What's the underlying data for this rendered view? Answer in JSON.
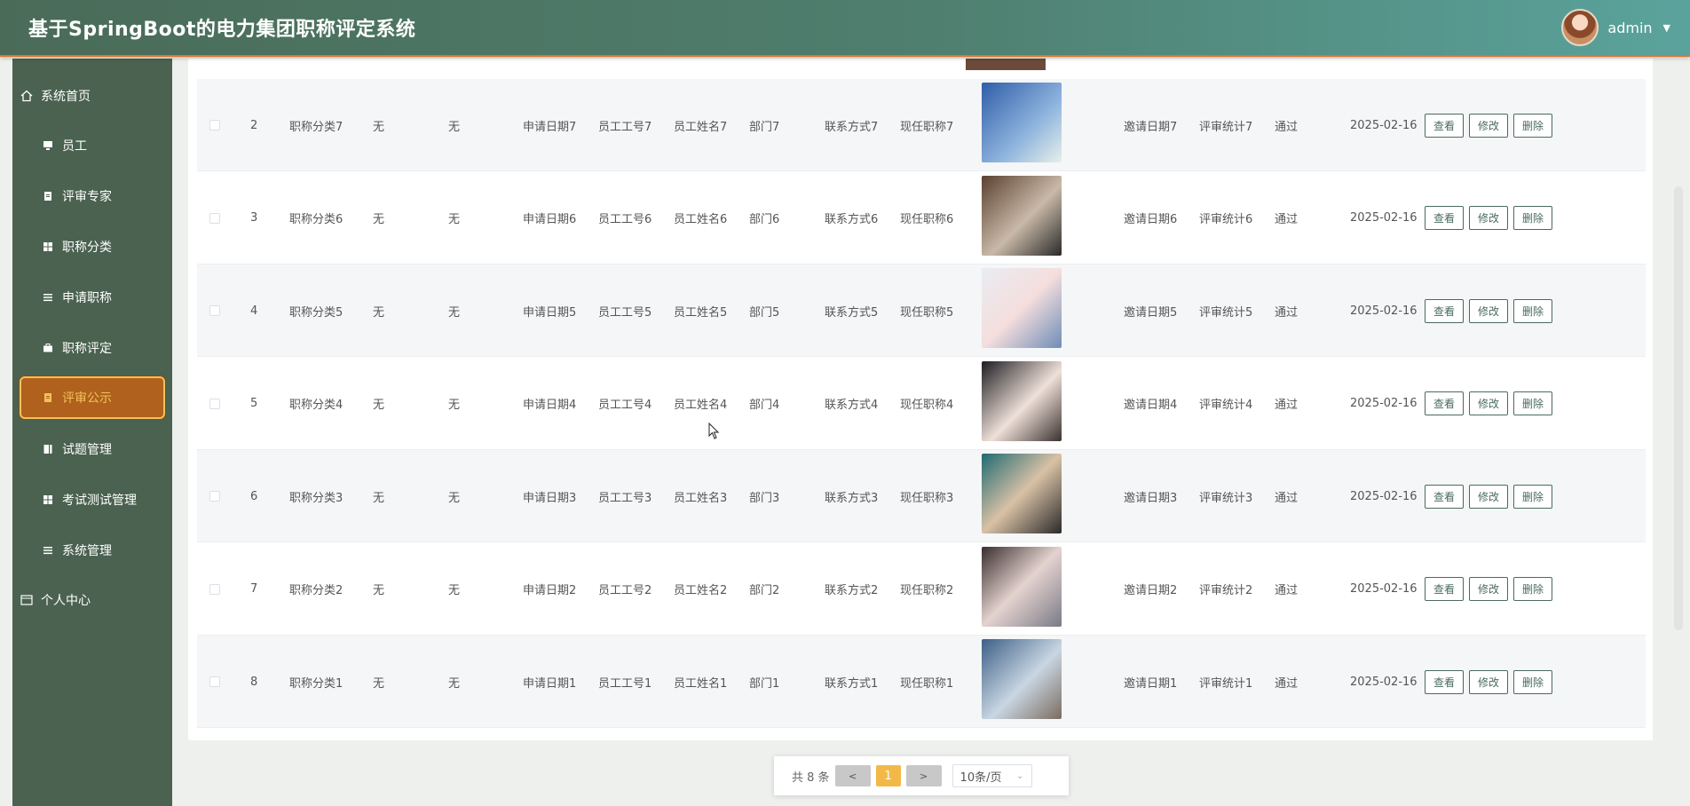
{
  "header": {
    "title": "基于SpringBoot的电力集团职称评定系统",
    "username": "admin"
  },
  "sidebar": {
    "items": [
      {
        "label": "系统首页",
        "icon": "home-icon"
      },
      {
        "label": "员工",
        "icon": "monitor-icon"
      },
      {
        "label": "评审专家",
        "icon": "clipboard-icon"
      },
      {
        "label": "职称分类",
        "icon": "grid-icon"
      },
      {
        "label": "申请职称",
        "icon": "list-icon"
      },
      {
        "label": "职称评定",
        "icon": "briefcase-icon"
      },
      {
        "label": "评审公示",
        "icon": "clipboard-icon",
        "active": true
      },
      {
        "label": "试题管理",
        "icon": "book-icon"
      },
      {
        "label": "考试测试管理",
        "icon": "grid-icon"
      },
      {
        "label": "系统管理",
        "icon": "list-icon"
      },
      {
        "label": "个人中心",
        "icon": "id-card-icon"
      }
    ]
  },
  "table": {
    "rows": [
      {
        "index": "2",
        "category": "职称分类7",
        "a": "无",
        "b": "无",
        "apply_date": "申请日期7",
        "emp_no": "员工工号7",
        "emp_name": "员工姓名7",
        "dept": "部门7",
        "contact": "联系方式7",
        "current_title": "现任职称7",
        "invite_date": "邀请日期7",
        "stats": "评审统计7",
        "status": "通过",
        "date": "2025-02-16"
      },
      {
        "index": "3",
        "category": "职称分类6",
        "a": "无",
        "b": "无",
        "apply_date": "申请日期6",
        "emp_no": "员工工号6",
        "emp_name": "员工姓名6",
        "dept": "部门6",
        "contact": "联系方式6",
        "current_title": "现任职称6",
        "invite_date": "邀请日期6",
        "stats": "评审统计6",
        "status": "通过",
        "date": "2025-02-16"
      },
      {
        "index": "4",
        "category": "职称分类5",
        "a": "无",
        "b": "无",
        "apply_date": "申请日期5",
        "emp_no": "员工工号5",
        "emp_name": "员工姓名5",
        "dept": "部门5",
        "contact": "联系方式5",
        "current_title": "现任职称5",
        "invite_date": "邀请日期5",
        "stats": "评审统计5",
        "status": "通过",
        "date": "2025-02-16"
      },
      {
        "index": "5",
        "category": "职称分类4",
        "a": "无",
        "b": "无",
        "apply_date": "申请日期4",
        "emp_no": "员工工号4",
        "emp_name": "员工姓名4",
        "dept": "部门4",
        "contact": "联系方式4",
        "current_title": "现任职称4",
        "invite_date": "邀请日期4",
        "stats": "评审统计4",
        "status": "通过",
        "date": "2025-02-16"
      },
      {
        "index": "6",
        "category": "职称分类3",
        "a": "无",
        "b": "无",
        "apply_date": "申请日期3",
        "emp_no": "员工工号3",
        "emp_name": "员工姓名3",
        "dept": "部门3",
        "contact": "联系方式3",
        "current_title": "现任职称3",
        "invite_date": "邀请日期3",
        "stats": "评审统计3",
        "status": "通过",
        "date": "2025-02-16"
      },
      {
        "index": "7",
        "category": "职称分类2",
        "a": "无",
        "b": "无",
        "apply_date": "申请日期2",
        "emp_no": "员工工号2",
        "emp_name": "员工姓名2",
        "dept": "部门2",
        "contact": "联系方式2",
        "current_title": "现任职称2",
        "invite_date": "邀请日期2",
        "stats": "评审统计2",
        "status": "通过",
        "date": "2025-02-16"
      },
      {
        "index": "8",
        "category": "职称分类1",
        "a": "无",
        "b": "无",
        "apply_date": "申请日期1",
        "emp_no": "员工工号1",
        "emp_name": "员工姓名1",
        "dept": "部门1",
        "contact": "联系方式1",
        "current_title": "现任职称1",
        "invite_date": "邀请日期1",
        "stats": "评审统计1",
        "status": "通过",
        "date": "2025-02-16"
      }
    ],
    "actions": {
      "view": "查看",
      "edit": "修改",
      "delete": "删除"
    }
  },
  "pagination": {
    "total": "共 8 条",
    "prev": "<",
    "page": "1",
    "next": ">",
    "page_size": "10条/页"
  },
  "colors": {
    "header_start": "#4a6b58",
    "header_end": "#5aa39c",
    "sidebar": "#4a624f",
    "active": "#b0611d",
    "accent": "#f3b948"
  }
}
